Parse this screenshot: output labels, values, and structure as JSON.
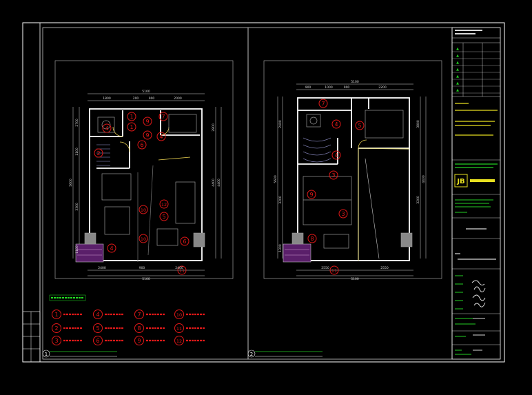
{
  "drawing": {
    "background": "#000000",
    "colors": {
      "frame": "#ffffff",
      "viewport": "#c8c8c8",
      "wall": "#ffffff",
      "dimension": "#d8d8d8",
      "annotation": "#e01818",
      "legend_title": "#23e023",
      "titleblock_green": "#23d023",
      "titleblock_yellow": "#e8e020",
      "titleblock_cyan": "#20c0e0",
      "door": "#e8d050",
      "stair": "#a0a0e0",
      "hatch": "#7a2a8a",
      "furniture": "#9a9a9a"
    }
  },
  "plans": [
    {
      "id": "plan-1",
      "label_no": "1",
      "dim_top": [
        "1800",
        "200",
        "900",
        "2000"
      ],
      "dim_top_total": "5100",
      "dim_bottom": [
        "2400",
        "900",
        "2400"
      ],
      "dim_bottom_total": "5100",
      "dim_left": [
        "2700",
        "1100",
        "3300",
        "1100"
      ],
      "dim_left_total": "5600",
      "dim_right": [
        "2800",
        "4400"
      ],
      "dim_right_total": "4400",
      "markers": [
        "1",
        "1",
        "4",
        "7",
        "9",
        "9",
        "4",
        "2",
        "6",
        "10",
        "12",
        "5",
        "10",
        "6",
        "4",
        "11"
      ]
    },
    {
      "id": "plan-2",
      "label_no": "2",
      "dim_top": [
        "900",
        "1000",
        "900",
        "2200"
      ],
      "dim_top_total": "5100",
      "dim_bottom": [
        "2550",
        "2550"
      ],
      "dim_bottom_total": "5100",
      "dim_left": [
        "2400",
        "3200",
        "1300"
      ],
      "dim_left_total": "5600",
      "dim_right": [
        "3800",
        "3200"
      ],
      "dim_right_total": "4400",
      "markers": [
        "7",
        "4",
        "5",
        "4",
        "3",
        "9",
        "3",
        "8",
        "11"
      ]
    }
  ],
  "legend": {
    "items": [
      {
        "num": "1"
      },
      {
        "num": "4"
      },
      {
        "num": "7"
      },
      {
        "num": "10"
      },
      {
        "num": "2"
      },
      {
        "num": "5"
      },
      {
        "num": "8"
      },
      {
        "num": "11"
      },
      {
        "num": "3"
      },
      {
        "num": "6"
      },
      {
        "num": "9"
      },
      {
        "num": "12"
      }
    ]
  },
  "titleblock": {
    "logo_text": "JB",
    "revision_marks": [
      "▲",
      "▲",
      "▲",
      "▲",
      "▲",
      "▲",
      "▲"
    ]
  }
}
